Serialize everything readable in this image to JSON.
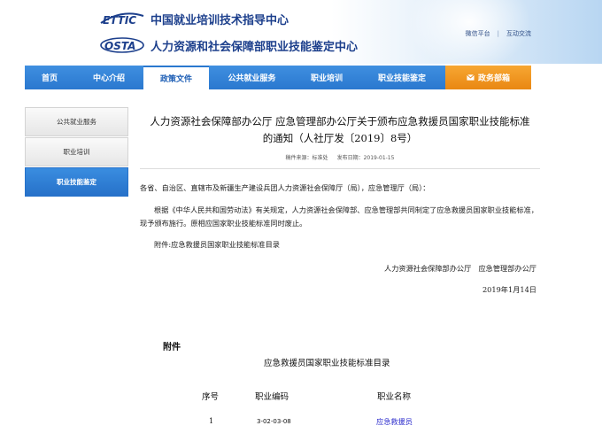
{
  "header": {
    "org1_logo": "ETTIC",
    "org1_name": "中国就业培训技术指导中心",
    "org2_logo": "OSTA",
    "org2_name": "人力资源和社会保障部职业技能鉴定中心",
    "links": [
      "微信平台",
      "互动交流"
    ]
  },
  "nav": {
    "items": [
      {
        "label": "首页",
        "width": 56
      },
      {
        "label": "中心介绍",
        "width": 78
      },
      {
        "label": "政策文件",
        "width": 74,
        "active": true
      },
      {
        "label": "公共就业服务",
        "width": 97
      },
      {
        "label": "职业培训",
        "width": 72
      },
      {
        "label": "职业技能鉴定",
        "width": 98
      }
    ],
    "gov_label": "政务部箱"
  },
  "sidebar": {
    "items": [
      {
        "label": "公共就业服务"
      },
      {
        "label": "职业培训"
      },
      {
        "label": "职业技能鉴定",
        "active": true
      }
    ]
  },
  "article": {
    "title": "人力资源社会保障部办公厅 应急管理部办公厅关于颁布应急救援员国家职业技能标准的通知（人社厅发〔2019〕8号）",
    "source": "稿件来源：标准处",
    "date": "发布日期：2019-01-15",
    "addressees": "各省、自治区、直辖市及新疆生产建设兵团人力资源社会保障厅（局），应急管理厅（局）：",
    "body": "根据《中华人民共和国劳动法》有关规定，人力资源社会保障部、应急管理部共同制定了应急救援员国家职业技能标准，现予颁布施行。原相应国家职业技能标准同时废止。",
    "attachment": "附件:应急救援员国家职业技能标准目录",
    "signatories": "人力资源社会保障部办公厅　应急管理部办公厅",
    "signed_date": "2019年1月14日",
    "appendix_label": "附件",
    "catalog_title": "应急救援员国家职业技能标准目录",
    "table": {
      "headers": [
        "序号",
        "职业编码",
        "职业名称"
      ],
      "rows": [
        [
          "1",
          "3-02-03-08",
          "应急救援员"
        ]
      ]
    }
  }
}
